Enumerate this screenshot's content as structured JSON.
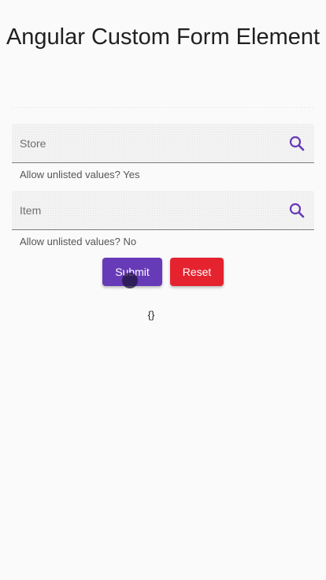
{
  "page": {
    "title": "Angular Custom Form Element"
  },
  "fields": [
    {
      "placeholder": "Store",
      "value": "",
      "hint": "Allow unlisted values? Yes",
      "icon": "search-icon"
    },
    {
      "placeholder": "Item",
      "value": "",
      "hint": "Allow unlisted values? No",
      "icon": "search-icon"
    }
  ],
  "actions": {
    "submit_label": "Submit",
    "reset_label": "Reset"
  },
  "output": {
    "json": "{}"
  },
  "colors": {
    "primary": "#673ab7",
    "warn": "#e5232f",
    "icon": "#673ab7"
  }
}
